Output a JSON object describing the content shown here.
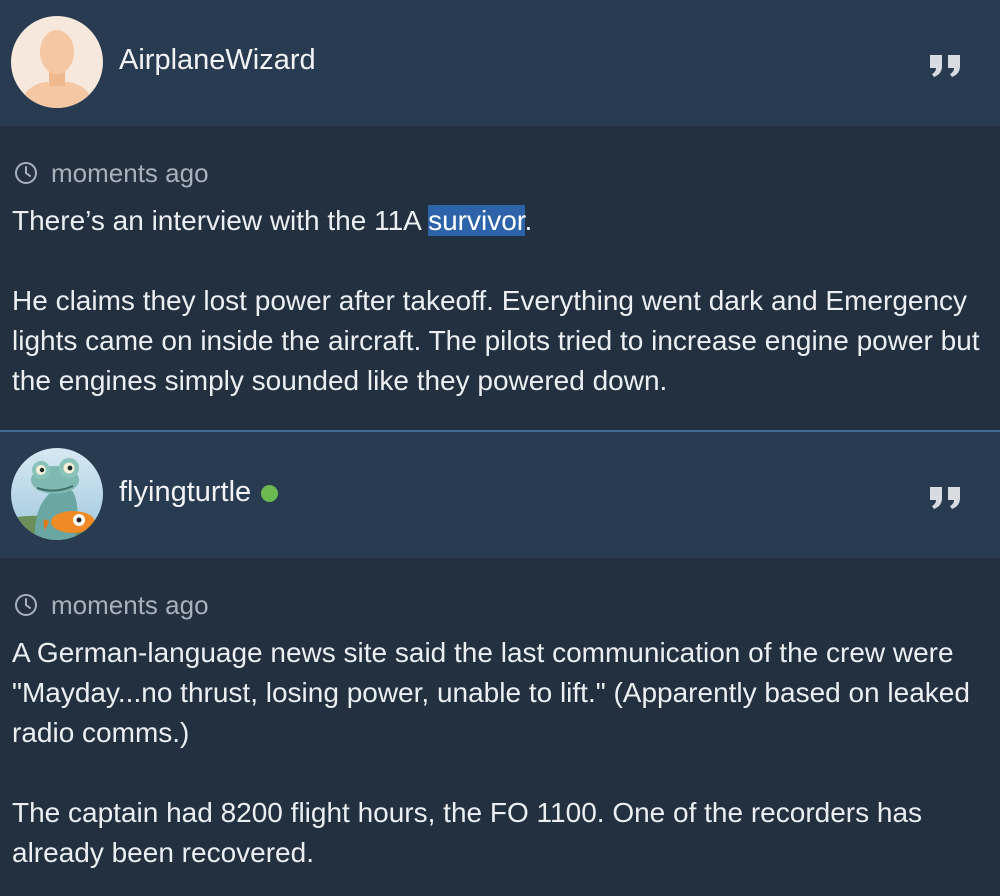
{
  "posts": [
    {
      "username": "AirplaneWizard",
      "online": false,
      "timestamp": "moments ago",
      "paragraphs": [
        {
          "before": "There’s an interview with the 11A ",
          "highlighted": "survivor",
          "after": "."
        },
        {
          "text": "He claims they lost power after takeoff. Everything went dark and Emergency lights came on inside the aircraft. The pilots tried to increase engine power but the engines simply sounded like they powered down."
        }
      ]
    },
    {
      "username": "flyingturtle",
      "online": true,
      "timestamp": "moments ago",
      "paragraphs": [
        {
          "text": "A German-language news site said the last communication of the crew were \"Mayday...no thrust, losing power, unable to lift.\" (Apparently based on leaked radio comms.)"
        },
        {
          "text": "The captain had 8200 flight hours, the FO 1100. One of the recorders has already been recovered."
        }
      ]
    }
  ],
  "icons": {
    "quote": "quote-icon",
    "clock": "clock-icon",
    "online": "online-status-dot"
  },
  "colors": {
    "header_bg": "#293b50",
    "body_bg": "#22303f",
    "highlight": "#2d63a8",
    "online": "#6cba4f",
    "separator": "#3f6b93"
  }
}
